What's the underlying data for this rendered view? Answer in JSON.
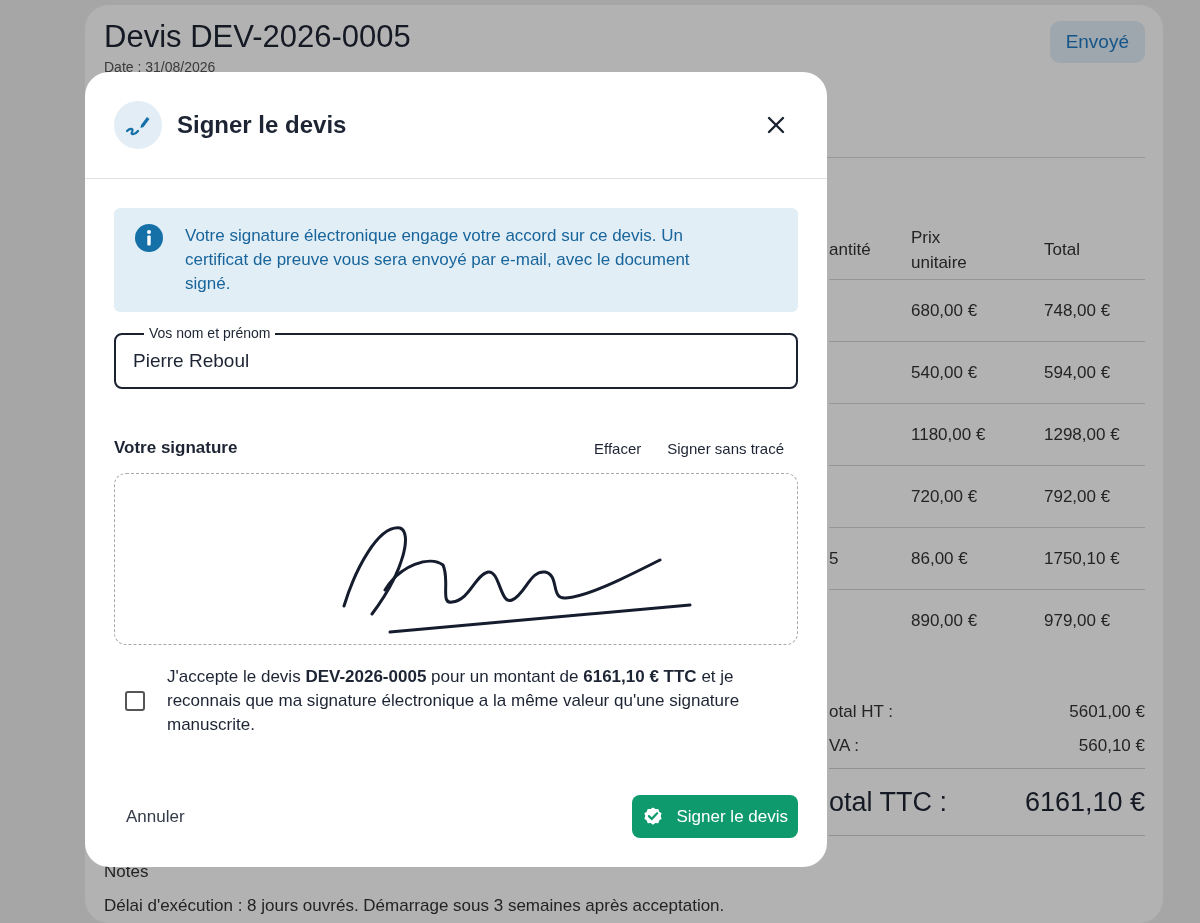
{
  "page": {
    "title": "Devis DEV-2026-0005",
    "date": "Date : 31/08/2026",
    "status": "Envoyé",
    "table": {
      "columns": [
        "antité",
        "Prix unitaire",
        "Total"
      ],
      "rows": [
        {
          "cells": [
            "",
            "680,00 €",
            "748,00 €"
          ]
        },
        {
          "cells": [
            "",
            "540,00 €",
            "594,00 €"
          ]
        },
        {
          "cells": [
            "",
            "1180,00 €",
            "1298,00 €"
          ]
        },
        {
          "cells": [
            "",
            "720,00 €",
            "792,00 €"
          ]
        },
        {
          "cells": [
            "5",
            "86,00 €",
            "1750,10 €"
          ]
        },
        {
          "cells": [
            "",
            "890,00 €",
            "979,00 €"
          ]
        }
      ]
    },
    "totals": [
      {
        "kind": "sub",
        "label": "otal HT :",
        "value": "5601,00 €"
      },
      {
        "kind": "sub",
        "label": "VA :",
        "value": "560,10 €"
      },
      {
        "kind": "grand",
        "label": "otal TTC :",
        "value": "6161,10 €"
      }
    ],
    "notes": {
      "title": "Notes",
      "text": "Délai d'exécution : 8 jours ouvrés. Démarrage sous 3 semaines après acceptation."
    }
  },
  "dialog": {
    "title": "Signer le devis",
    "info": "Votre signature électronique engage votre accord sur ce devis. Un certificat de preuve vous sera envoyé par e-mail, avec le document signé.",
    "name_field": {
      "label": "Vos nom et prénom",
      "value": "Pierre Reboul"
    },
    "signature": {
      "label": "Votre signature",
      "actions": [
        "Effacer",
        "Signer sans tracé"
      ]
    },
    "consent": {
      "text": "J'accepte le devis **DEV-2026-0005** pour un montant de **6161,10 € TTC** et je reconnais que ma signature électronique a la même valeur qu'une signature manuscrite.",
      "checked": false
    },
    "buttons": {
      "cancel": "Annuler",
      "confirm": "Signer le devis"
    }
  }
}
